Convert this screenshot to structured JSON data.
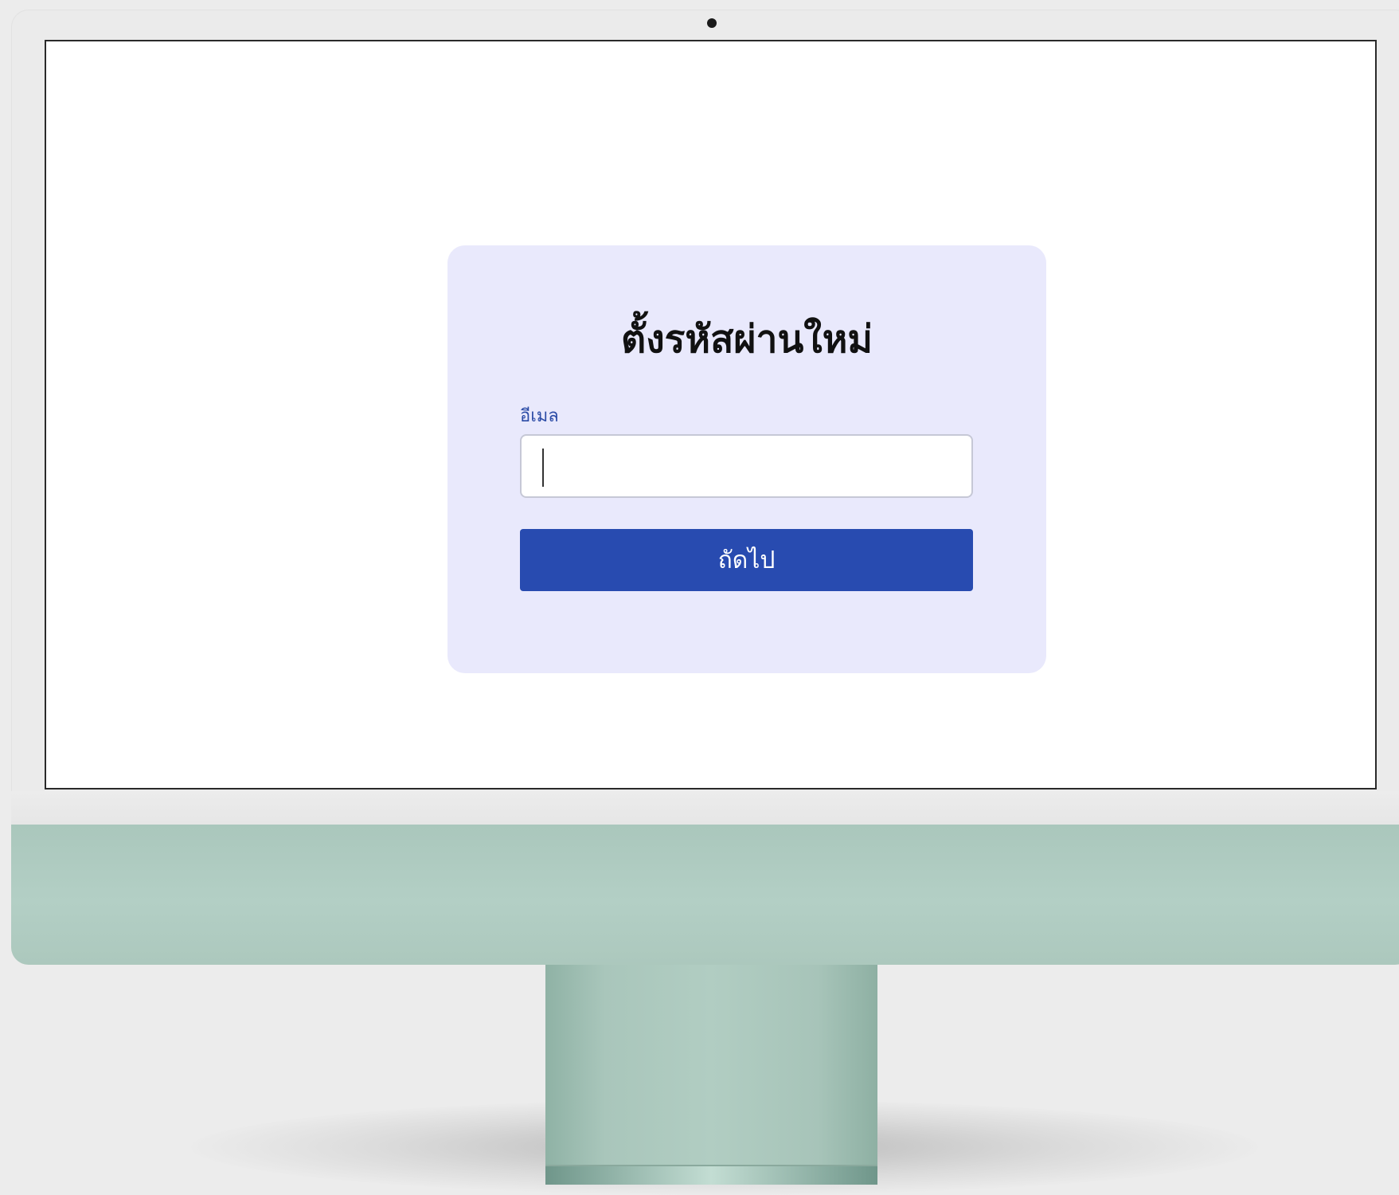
{
  "dialog": {
    "title": "ตั้งรหัสผ่านใหม่",
    "email_label": "อีเมล",
    "email_value": "",
    "next_button_label": "ถัดไป"
  },
  "colors": {
    "card_background": "#e9e9fc",
    "accent_button": "#284bb0",
    "label_text": "#2b4ba6",
    "monitor_chin": "#b0cbc1"
  }
}
